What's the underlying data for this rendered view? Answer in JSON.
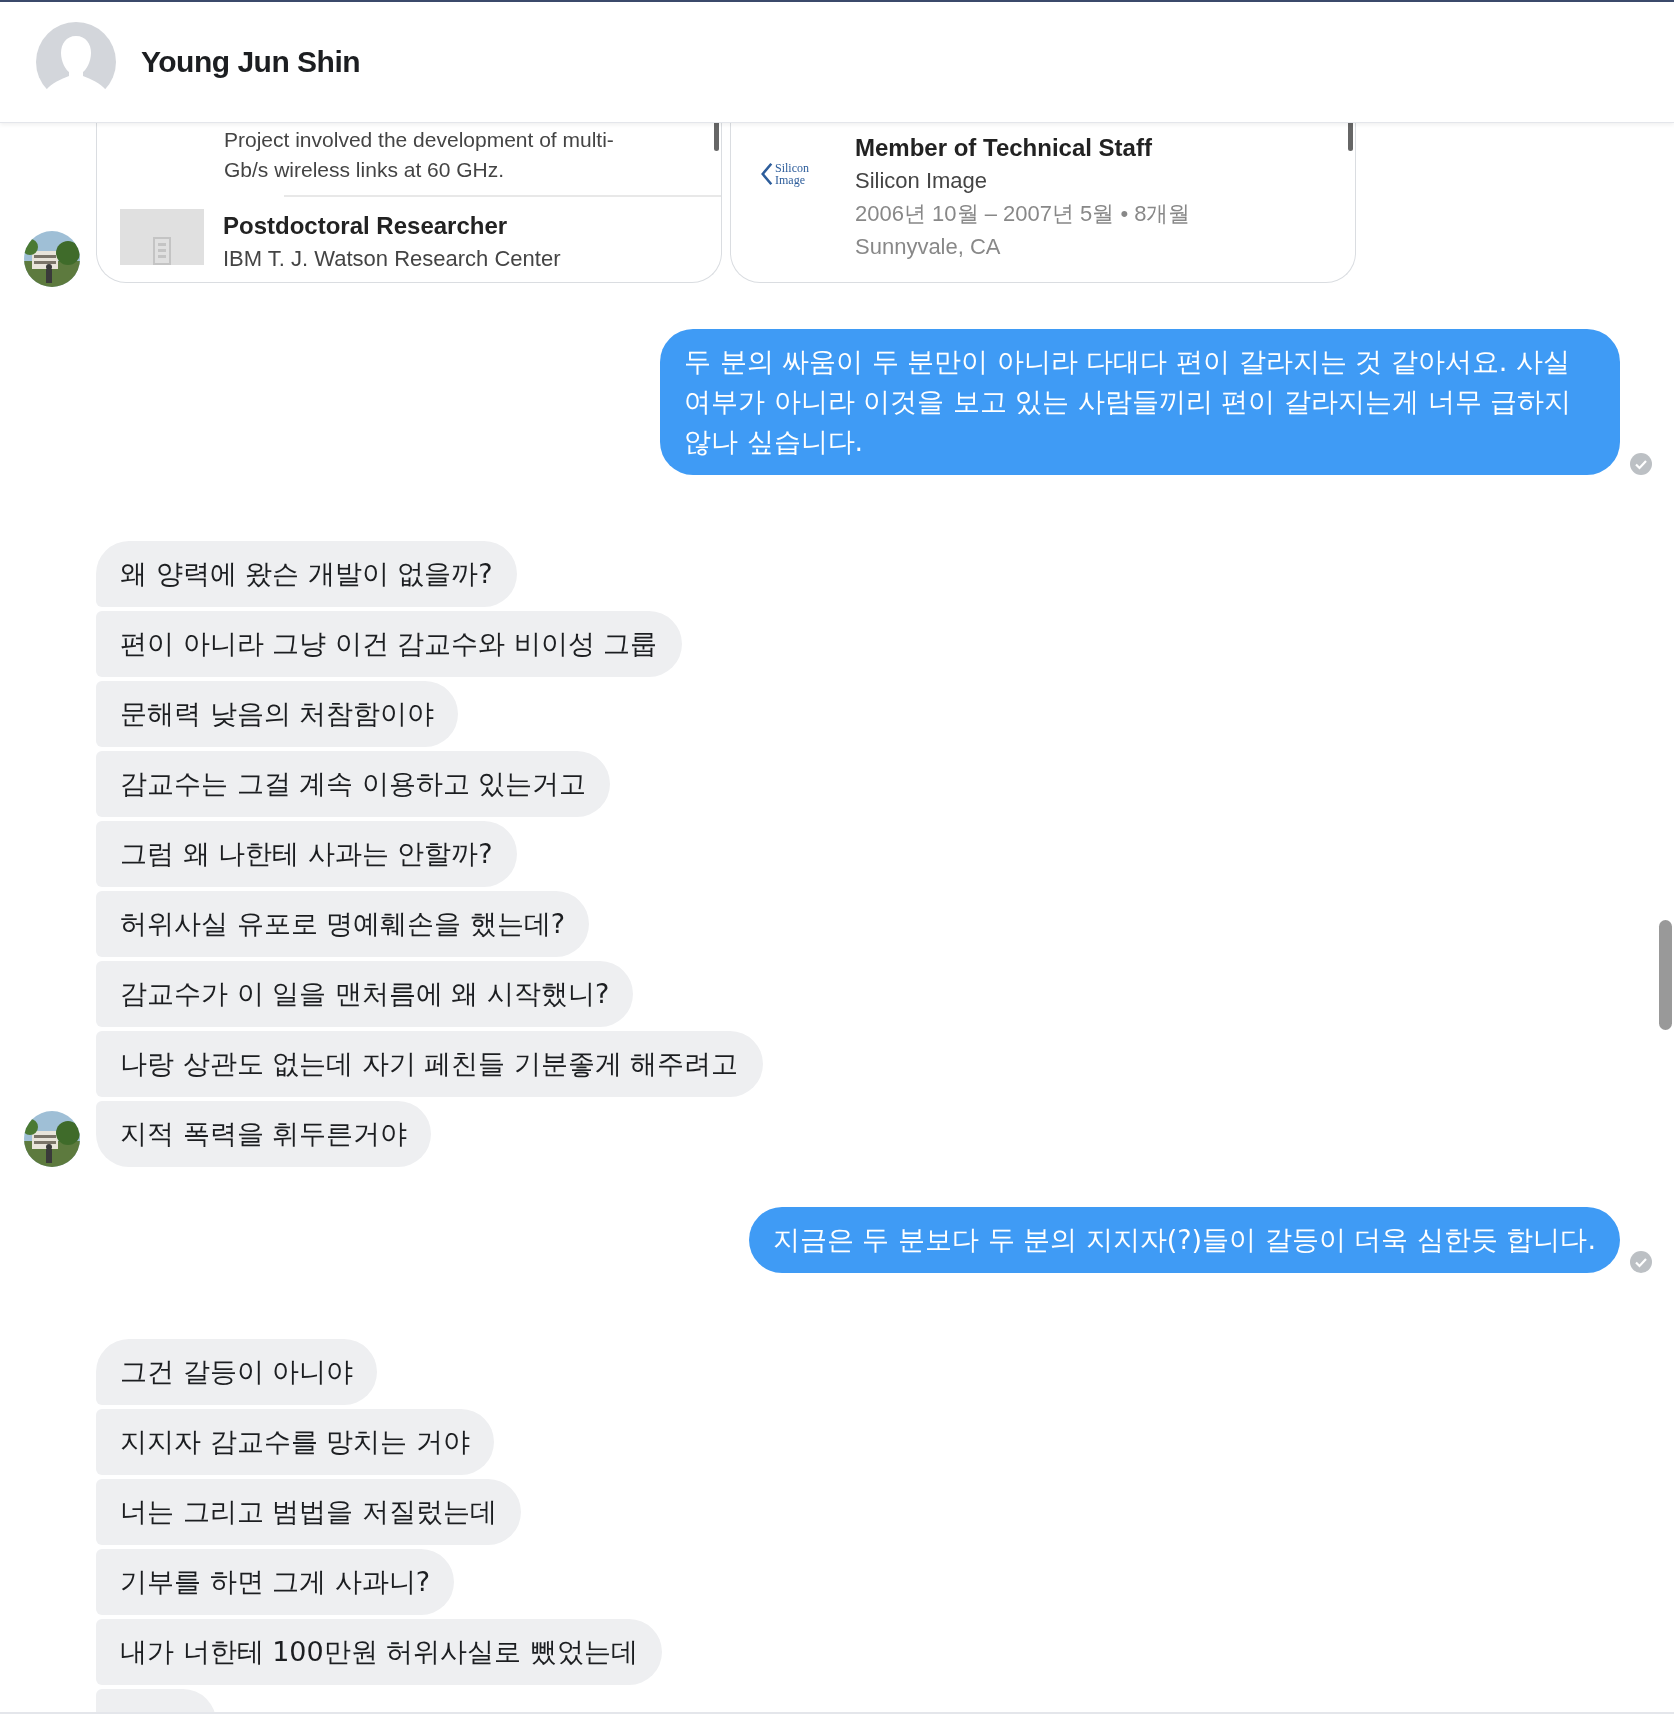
{
  "header": {
    "name": "Young Jun Shin"
  },
  "conversation": [
    {
      "kind": "cards",
      "avatar": true,
      "cards": [
        {
          "description": [
            "Project involved the development of multi-",
            "Gb/s wireless links at 60 GHz."
          ],
          "title": "Postdoctoral Researcher",
          "company": "IBM T. J. Watson Research Center"
        },
        {
          "logo_text": [
            "Silicon",
            "Image"
          ],
          "title": "Member of Technical Staff",
          "company": "Silicon Image",
          "dates": "2006년 10월 – 2007년 5월 • 8개월",
          "location": "Sunnyvale, CA"
        }
      ]
    },
    {
      "kind": "outgoing",
      "text": "두 분의 싸움이 두 분만이 아니라 다대다 편이 갈라지는 것 같아서요. 사실여부가 아니라 이것을 보고 있는 사람들끼리 편이 갈라지는게 너무 급하지 않나 싶습니다.",
      "read": true
    },
    {
      "kind": "incoming",
      "avatar": true,
      "bubbles": [
        "왜 양력에 왔슨 개발이 없을까?",
        "편이 아니라 그냥 이건 감교수와 비이성 그룹",
        "문해력 낮음의 처참함이야",
        "감교수는 그걸 계속 이용하고 있는거고",
        "그럼 왜 나한테 사과는 안할까?",
        "허위사실 유포로 명예훼손을 했는데?",
        "감교수가 이 일을 맨처름에 왜 시작했니?",
        "나랑 상관도 없는데 자기 페친들 기분좋게 해주려고",
        "지적 폭력을 휘두른거야"
      ]
    },
    {
      "kind": "outgoing",
      "text": "지금은 두 분보다 두 분의 지지자(?)들이 갈등이 더욱 심한듯 합니다.",
      "read": true
    },
    {
      "kind": "incoming",
      "avatar": false,
      "more_below": true,
      "bubbles": [
        "그건 갈등이 아니야",
        "지지자 감교수를 망치는 거야",
        "너는 그리고 범법을 저질렀는데",
        "기부를 하면 그게 사과니?",
        "내가 너한테 100만원 허위사실로 뺐었는데"
      ]
    }
  ]
}
